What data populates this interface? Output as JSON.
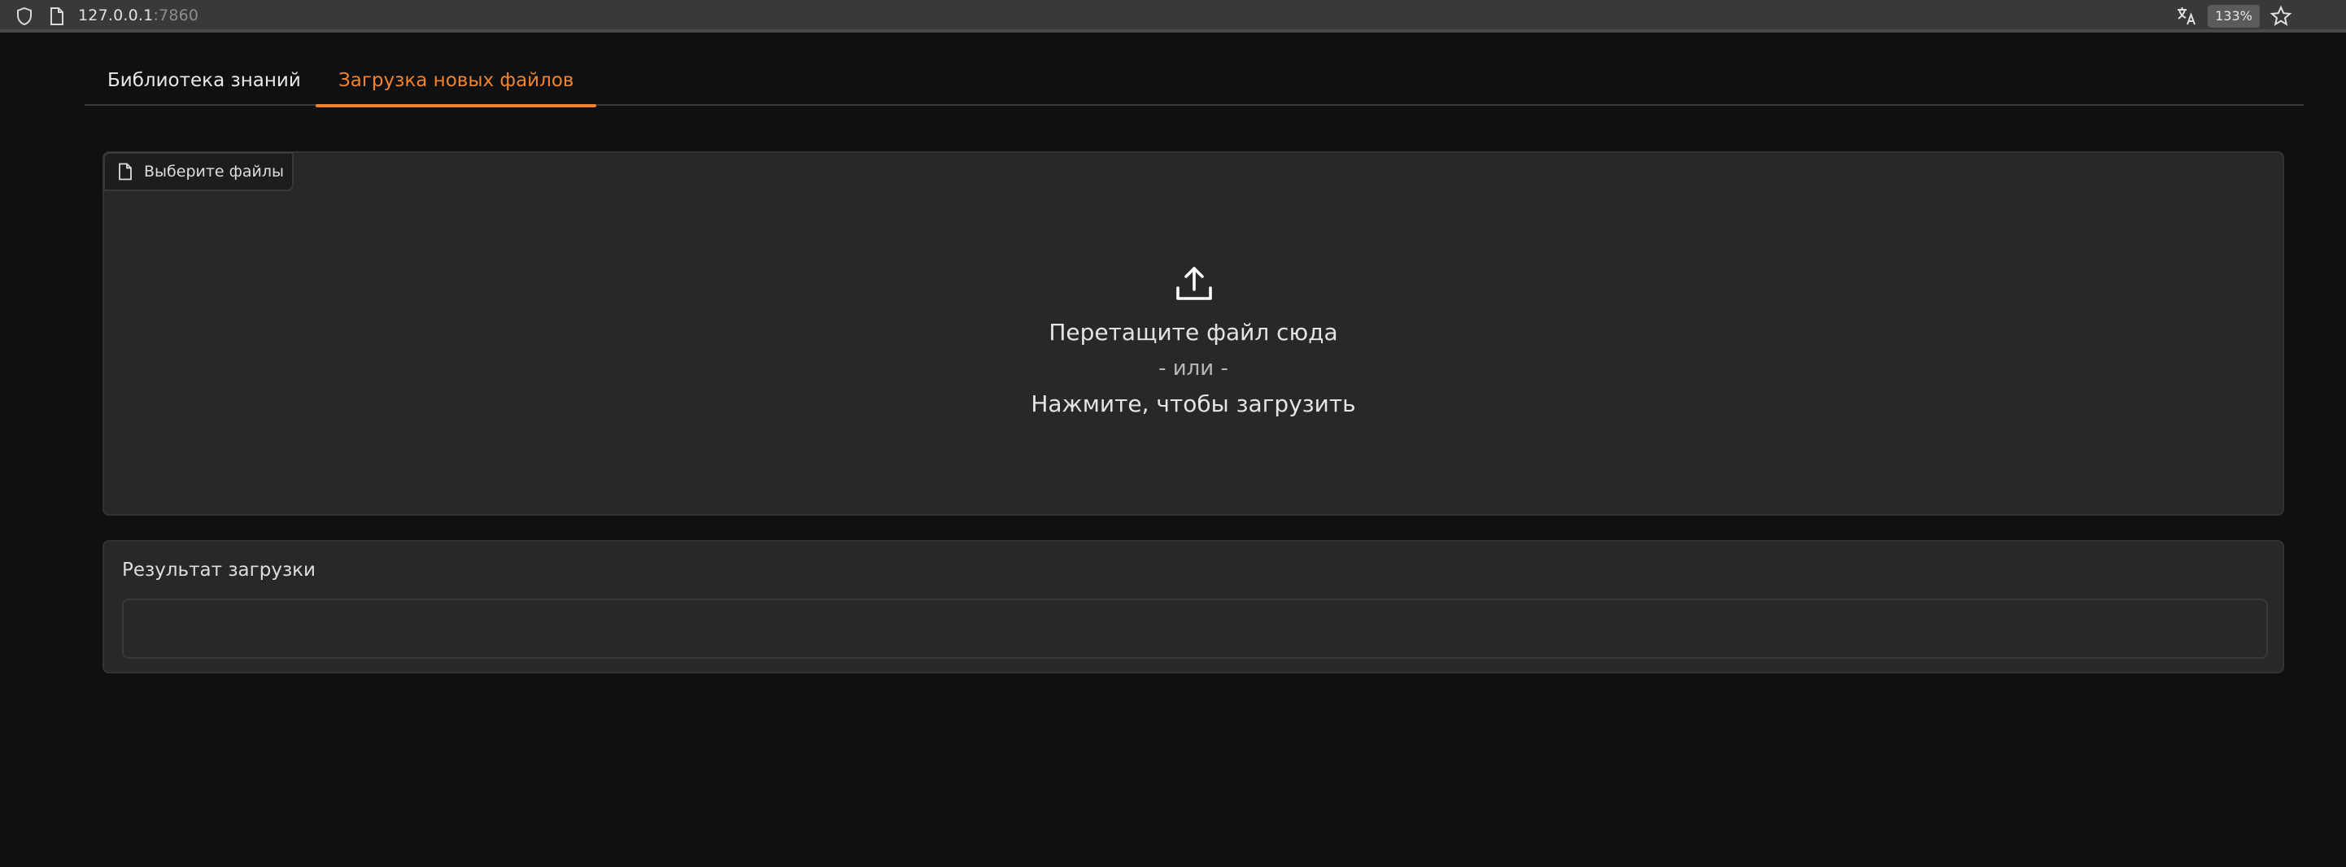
{
  "browser": {
    "url_host": "127.0.0.1",
    "url_port": ":7860",
    "zoom": "133%",
    "icons": [
      "shield-icon",
      "page-icon",
      "translate-icon",
      "star-icon"
    ]
  },
  "tabs": [
    {
      "label": "Библиотека знаний",
      "active": false
    },
    {
      "label": "Загрузка новых файлов",
      "active": true
    }
  ],
  "upload": {
    "file_label": "Выберите файлы",
    "drop_text": "Перетащите файл сюда",
    "or_text": "- или -",
    "click_text": "Нажмите, чтобы загрузить",
    "icon": "upload-icon"
  },
  "result": {
    "label": "Результат загрузки",
    "value": ""
  },
  "colors": {
    "accent": "#f0832b",
    "background": "#0f1011",
    "panel": "#27282a"
  }
}
